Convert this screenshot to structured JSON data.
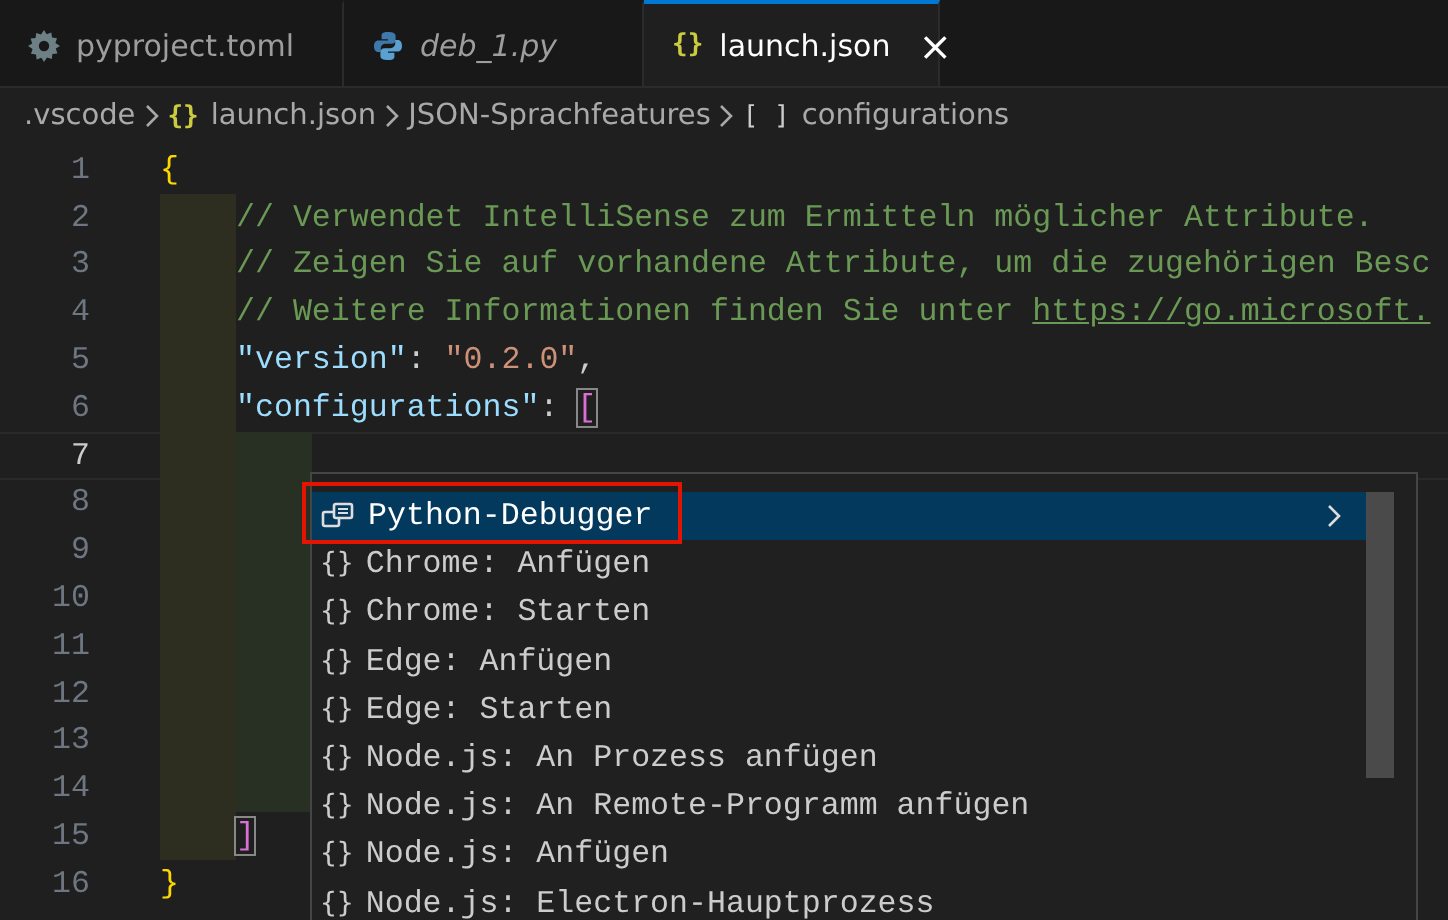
{
  "tabs": [
    {
      "label": "pyproject.toml",
      "kind": "settings",
      "preview": false,
      "selected": false
    },
    {
      "label": "deb_1.py",
      "kind": "python",
      "preview": true,
      "selected": false
    },
    {
      "label": "launch.json",
      "kind": "json",
      "icon": "{}",
      "preview": false,
      "selected": true,
      "close": "×"
    }
  ],
  "breadcrumbs": [
    {
      "label": ".vscode"
    },
    {
      "label": "launch.json",
      "icon": "{}"
    },
    {
      "label": "JSON-Sprachfeatures"
    },
    {
      "label": "configurations",
      "icon": "[ ]"
    }
  ],
  "editor": {
    "lines": [
      {
        "number": "1",
        "current": false,
        "tokens": [
          {
            "kind": "brace",
            "text": "{"
          }
        ],
        "children": [
          {
            "number": "2",
            "current": false,
            "tokens": [
              {
                "kind": "comment",
                "text": "// Verwendet IntelliSense zum Ermitteln möglicher Attribute."
              }
            ]
          },
          {
            "number": "3",
            "current": false,
            "tokens": [
              {
                "kind": "comment",
                "text": "// Zeigen Sie auf vorhandene Attribute, um die zugehörigen Besc"
              }
            ]
          },
          {
            "number": "4",
            "current": false,
            "tokens": [
              {
                "kind": "comment",
                "text": "// Weitere Informationen finden Sie unter "
              },
              {
                "kind": "link",
                "text": "https://go.microsoft."
              }
            ]
          },
          {
            "number": "5",
            "current": false,
            "tokens": [
              {
                "kind": "key",
                "text": "\"version\""
              },
              {
                "kind": "punct",
                "text": ": "
              },
              {
                "kind": "string",
                "text": "\"0.2.0\""
              },
              {
                "kind": "punct",
                "text": ","
              }
            ]
          },
          {
            "number": "6",
            "current": false,
            "tokens": [
              {
                "kind": "key",
                "text": "\"configurations\""
              },
              {
                "kind": "punct",
                "text": ": "
              },
              {
                "kind": "bracket",
                "text": "[",
                "matched": true
              }
            ],
            "children": [
              {
                "number": "7",
                "current": true
              },
              {
                "number": "8",
                "current": false
              },
              {
                "number": "9",
                "current": false
              },
              {
                "number": "10",
                "current": false
              },
              {
                "number": "11",
                "current": false
              },
              {
                "number": "12",
                "current": false
              },
              {
                "number": "13",
                "current": false
              },
              {
                "number": "14",
                "current": false
              }
            ]
          },
          {
            "number": "15",
            "current": false,
            "tokens": [
              {
                "kind": "bracket",
                "text": "]",
                "matched": true
              }
            ]
          }
        ]
      },
      {
        "number": "16",
        "current": false,
        "tokens": [
          {
            "kind": "brace",
            "text": "}"
          }
        ]
      }
    ]
  },
  "suggestions": {
    "items": [
      {
        "label": "Python-Debugger",
        "kind": "module",
        "selected": true,
        "highlighted": true,
        "more": true
      },
      {
        "label": "Chrome: Anfügen",
        "kind": "snippet",
        "icon": "{}",
        "selected": false,
        "highlighted": false,
        "more": false
      },
      {
        "label": "Chrome: Starten",
        "kind": "snippet",
        "icon": "{}",
        "selected": false,
        "highlighted": false,
        "more": false
      },
      {
        "label": "Edge: Anfügen",
        "kind": "snippet",
        "icon": "{}",
        "selected": false,
        "highlighted": false,
        "more": false
      },
      {
        "label": "Edge: Starten",
        "kind": "snippet",
        "icon": "{}",
        "selected": false,
        "highlighted": false,
        "more": false
      },
      {
        "label": "Node.js: An Prozess anfügen",
        "kind": "snippet",
        "icon": "{}",
        "selected": false,
        "highlighted": false,
        "more": false
      },
      {
        "label": "Node.js: An Remote-Programm anfügen",
        "kind": "snippet",
        "icon": "{}",
        "selected": false,
        "highlighted": false,
        "more": false
      },
      {
        "label": "Node.js: Anfügen",
        "kind": "snippet",
        "icon": "{}",
        "selected": false,
        "highlighted": false,
        "more": false
      },
      {
        "label": "Node.js: Electron-Hauptprozess",
        "kind": "snippet",
        "icon": "{}",
        "selected": false,
        "highlighted": false,
        "more": false
      }
    ]
  }
}
